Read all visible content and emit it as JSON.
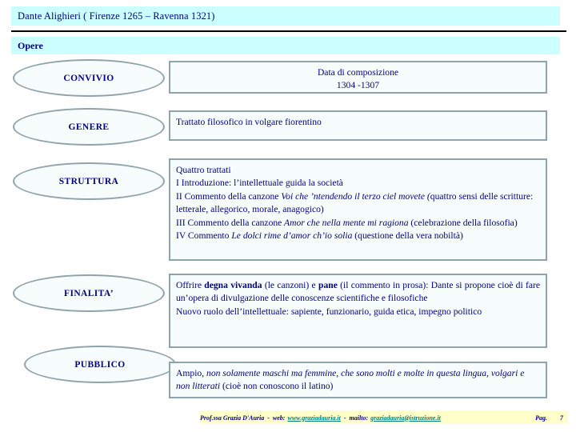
{
  "header": {
    "title": "Dante Alighieri ( Firenze 1265 – Ravenna 1321)",
    "subtitle": "Opere",
    "bar_color": "#ccffff",
    "text_color": "#000080"
  },
  "theme": {
    "shape_border": "#8fa3ab",
    "shape_fill": "#f7fcfd",
    "text": "#000080",
    "footer_bar": "#ffffcc",
    "link": "#008080"
  },
  "rows": [
    {
      "label": "CONVIVIO",
      "align": "center",
      "content_html": "Data di composizione<br>1304 -1307"
    },
    {
      "label": "GENERE",
      "align": "left",
      "content_html": "Trattato filosofico in volgare fiorentino"
    },
    {
      "label": "STRUTTURA",
      "align": "left",
      "content_html": "Quattro trattati<br>I Introduzione: l’intellettuale guida la società<br>II Commento della canzone <i>Voi che ’ntendendo il terzo ciel movete (</i>quattro sensi delle scritture: letterale, allegorico, morale, anagogico)<br>III Commento della canzone<i> Amor che nella mente mi ragiona </i>(celebrazione della filosofia)<br>IV Commento  <i>Le dolci rime d’amor ch’io solia </i>(questione della vera nobiltà)"
    },
    {
      "label": "FINALITA’",
      "align": "justify",
      "content_html": "Offrire <b>degna vivanda</b> (le canzoni) e <b>pane</b> (il commento in prosa): Dante si propone cioè di fare un’opera di divulgazione delle conoscenze scientifiche e filosofiche<br>Nuovo ruolo dell’intellettuale: sapiente, funzionario, guida etica, impegno politico"
    },
    {
      "label": "PUBBLICO",
      "align": "left",
      "content_html": "Ampio, <i>non solamente maschi ma femmine, che sono molti e molte in questa lingua, volgari e non litterati </i>(cioè non conoscono il latino)"
    }
  ],
  "footer": {
    "author": "Prof.ssa Grazia D'Auria",
    "sep1": "-",
    "web_label": "web:",
    "web_url": "www.graziadauria.it",
    "sep2": "-",
    "mail_label": "mailto:",
    "mail_url": "graziadauria@istruzione.it",
    "page_label": "Pag.",
    "page_number": "7"
  }
}
